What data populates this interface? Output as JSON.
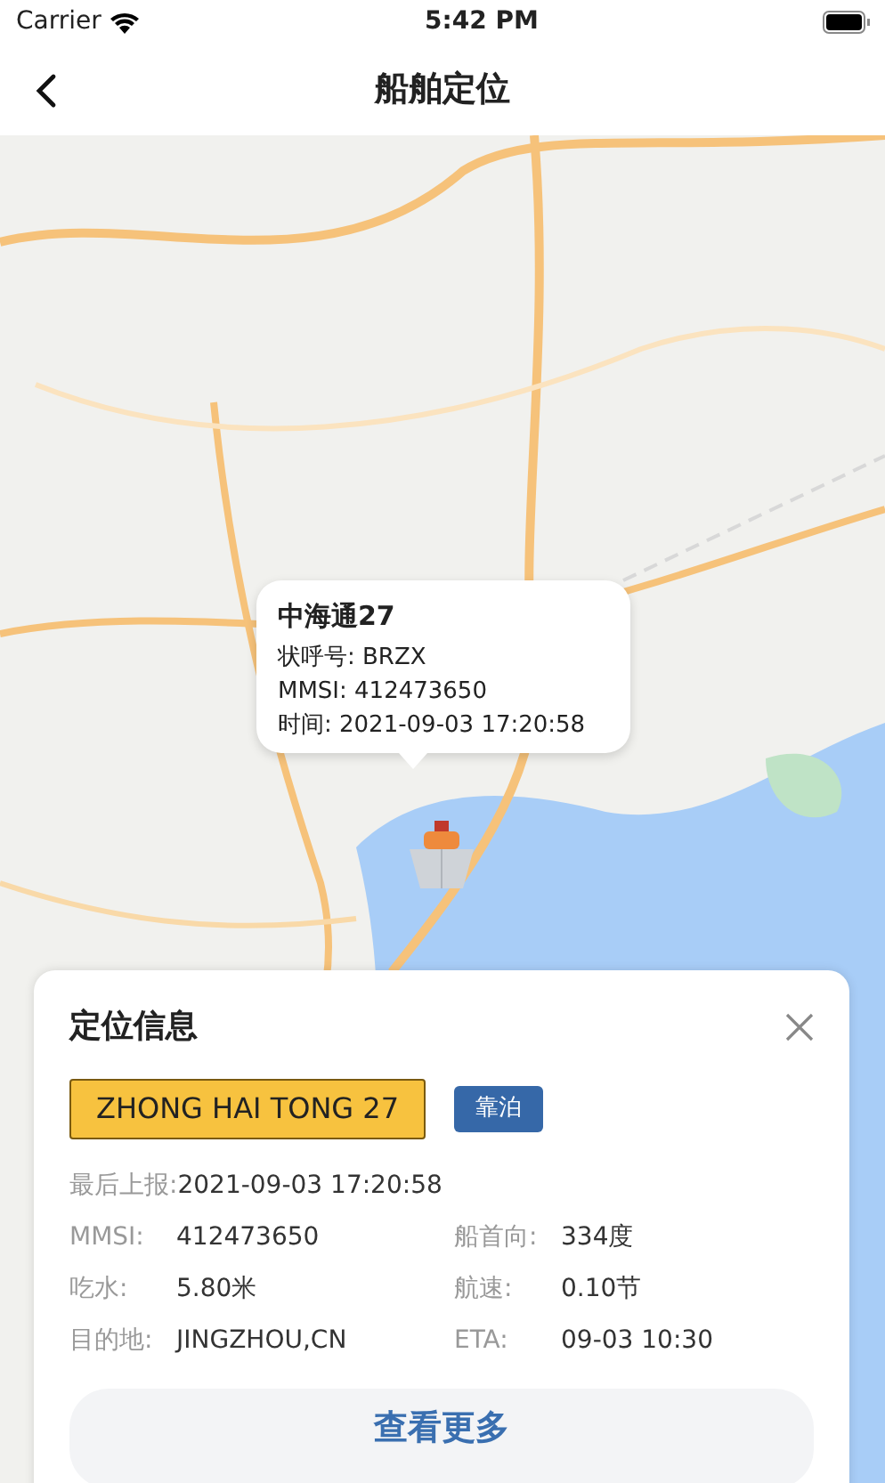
{
  "status_bar": {
    "carrier": "Carrier",
    "time": "5:42 PM"
  },
  "nav_bar": {
    "title": "船舶定位"
  },
  "popup": {
    "name": "中海通27",
    "lines": [
      "状呼号: BRZX",
      "MMSI: 412473650",
      "时间: 2021-09-03 17:20:58"
    ]
  },
  "panel": {
    "title": "定位信息",
    "ship_name": "ZHONG HAI TONG 27",
    "status_tag": "靠泊",
    "last_report": {
      "label": "最后上报:",
      "value": "2021-09-03 17:20:58"
    },
    "fields": [
      {
        "label": "MMSI:",
        "value": "412473650"
      },
      {
        "label": "船首向:",
        "value": "334度"
      },
      {
        "label": "吃水:",
        "value": "5.80米"
      },
      {
        "label": "航速:",
        "value": "0.10节"
      },
      {
        "label": "目的地:",
        "value": "JINGZHOU,CN"
      },
      {
        "label": "ETA:",
        "value": "09-03 10:30"
      }
    ],
    "more_button": "查看更多"
  }
}
